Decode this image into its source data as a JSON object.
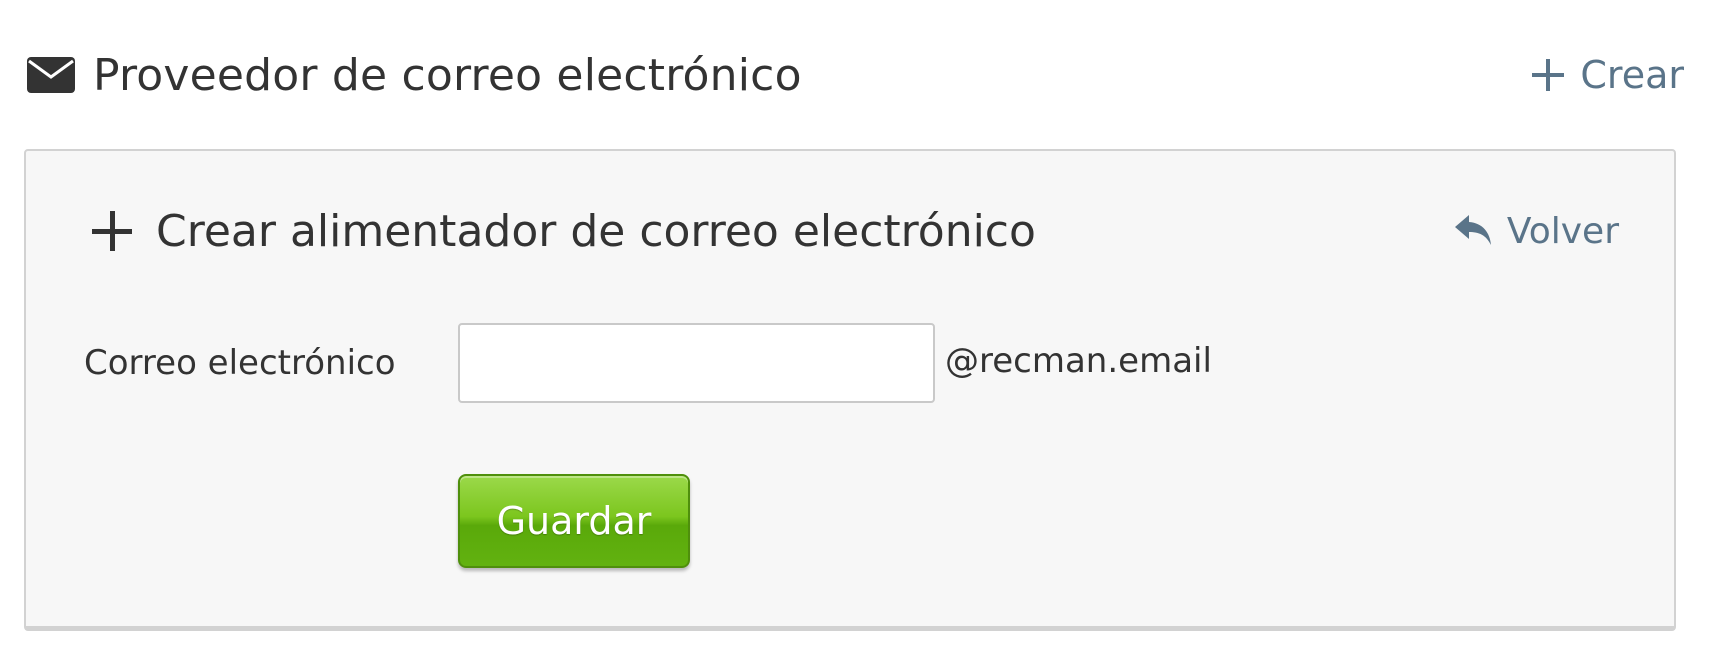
{
  "header": {
    "title": "Proveedor de correo electrónico",
    "create_label": "Crear",
    "icon": "envelope-icon"
  },
  "panel": {
    "title": "Crear alimentador de correo electrónico",
    "back_label": "Volver",
    "title_icon": "plus-icon",
    "back_icon": "reply-arrow-icon"
  },
  "form": {
    "email_label": "Correo electrónico",
    "email_value": "",
    "email_placeholder": "",
    "domain_suffix": "@recman.email",
    "save_label": "Guardar"
  },
  "colors": {
    "link": "#5a7489",
    "text": "#333333",
    "panel_bg": "#f7f7f7",
    "button_green": "#6cb915"
  }
}
